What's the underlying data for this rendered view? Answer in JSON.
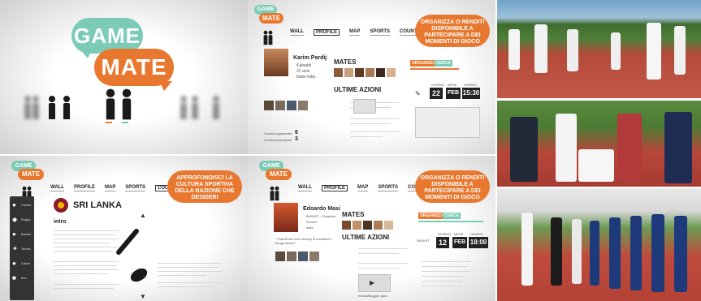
{
  "logo": {
    "line1": "GAME",
    "line2": "MATE"
  },
  "nav": {
    "wall": "WALL",
    "profile": "PROFILE",
    "map": "MAP",
    "sports": "SPORTS",
    "countries": "COUNTRIES"
  },
  "bubble_organize": "ORGANIZZA O RENDITI DISPONIBILE A PARTECIPARE A DEI MOMENTI DI GIOCO",
  "bubble_approfondisci": "APPROFONDISCI LA CULTURA SPORTIVA DELLA NAZIONE CHE DESIDERI",
  "profile1": {
    "name": "Karim Pardij",
    "details": [
      "Kabaddi",
      "22 anni",
      "Italia-India"
    ],
    "mates_label": "MATES",
    "actions_label": "ULTIME AZIONI",
    "tabs": [
      "ORGANIZZA",
      "CERCA"
    ],
    "date": {
      "day_label": "GIORNO",
      "month_label": "MESE",
      "hour_label": "ORARIO",
      "day": "22",
      "month": "FEB",
      "time": "15:30"
    },
    "counts": [
      {
        "label": "Gravità organizzate",
        "value": "6"
      },
      {
        "label": "Gravità partecipate",
        "value": "3"
      }
    ]
  },
  "profile2": {
    "name": "Edoardo Masi",
    "details": [
      "BASKET - Physioiko",
      "25 anni",
      "Italia"
    ],
    "quote": "\" Fratelli dori frere bounty di undefeat e bongo sticker\"",
    "mates_label": "MATES",
    "actions_label": "ULTIME AZIONI",
    "tabs": [
      "ORGANIZZA",
      "CERCA"
    ],
    "date": {
      "day_label": "GIORNO",
      "month_label": "MESE",
      "hour_label": "ORARIO",
      "day": "12",
      "month": "FEB",
      "time": "18:00"
    },
    "sport_label": "BASKET",
    "list": [
      "Kerala/Baggan ganz"
    ]
  },
  "country": {
    "name": "SRI LANKA",
    "section": "intro",
    "sidebar": [
      "Cricket",
      "Rugby",
      "Basket",
      "Tennis",
      "Calcio",
      "Box"
    ]
  },
  "colors": {
    "teal": "#7ccbb6",
    "orange": "#e8782f",
    "dark": "#222222"
  },
  "icons": [
    "person-icon",
    "flag-icon",
    "calendar-icon",
    "cricket-bat-icon",
    "rugby-ball-icon"
  ]
}
